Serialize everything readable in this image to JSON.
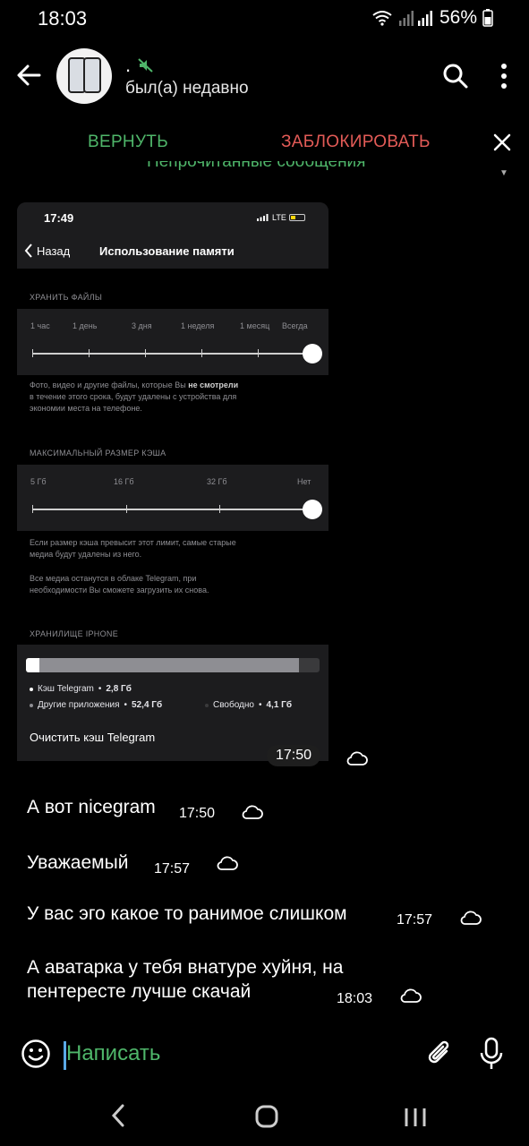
{
  "status_bar": {
    "time": "18:03",
    "battery": "56%"
  },
  "header": {
    "name": ".",
    "status": "был(а) недавно",
    "muted_icon": "muted-speaker-icon"
  },
  "action_bar": {
    "return_label": "ВЕРНУТЬ",
    "block_label": "ЗАБЛОКИРОВАТЬ",
    "pinned_label": "Непрочитанные сообщения"
  },
  "image_message": {
    "time": "17:50",
    "screenshot": {
      "time": "17:49",
      "network": "LTE",
      "back_label": "Назад",
      "title": "Использование памяти",
      "keep_files": {
        "header": "ХРАНИТЬ ФАЙЛЫ",
        "options": [
          "1 час",
          "1 день",
          "3 дня",
          "1 неделя",
          "1 месяц",
          "Всегда"
        ],
        "selected_index": 5,
        "note_part1": "Фото, видео и другие файлы, которые Вы ",
        "note_bold": "не смотрели",
        "note_line2": "в течение этого срока, будут удалены с устройства для",
        "note_line3": "экономии места на телефоне."
      },
      "cache_size": {
        "header": "МАКСИМАЛЬНЫЙ РАЗМЕР КЭША",
        "options": [
          "5 Гб",
          "16 Гб",
          "32 Гб",
          "Нет"
        ],
        "selected_index": 3,
        "note1_line1": "Если размер кэша превысит этот лимит, самые старые",
        "note1_line2": "медиа будут удалены из него.",
        "note2_line1": "Все медиа останутся в облаке Telegram, при",
        "note2_line2": "необходимости Вы сможете загрузить их снова."
      },
      "storage": {
        "header": "ХРАНИЛИЩЕ IPHONE",
        "telegram_label": "Кэш Telegram",
        "telegram_value": "2,8 Гб",
        "other_label": "Другие приложения",
        "other_value": "52,4 Гб",
        "free_label": "Свободно",
        "free_value": "4,1 Гб",
        "telegram_gb": 2.8,
        "other_gb": 52.4,
        "free_gb": 4.1,
        "clear_label": "Очистить кэш Telegram"
      }
    }
  },
  "messages": [
    {
      "text": "А вот nicegram",
      "time": "17:50"
    },
    {
      "text": "Уважаемый",
      "time": "17:57"
    },
    {
      "text": "У вас эго какое то ранимое слишком",
      "time": "17:57"
    },
    {
      "text_line1": "А аватарка у тебя внатуре хуйня, на",
      "text_line2": "пентересте лучше скачай",
      "time": "18:03"
    }
  ],
  "input": {
    "placeholder": "Написать"
  },
  "colors": {
    "accent_green": "#4fb66a",
    "block_red": "#e35b57",
    "background": "#000000"
  }
}
